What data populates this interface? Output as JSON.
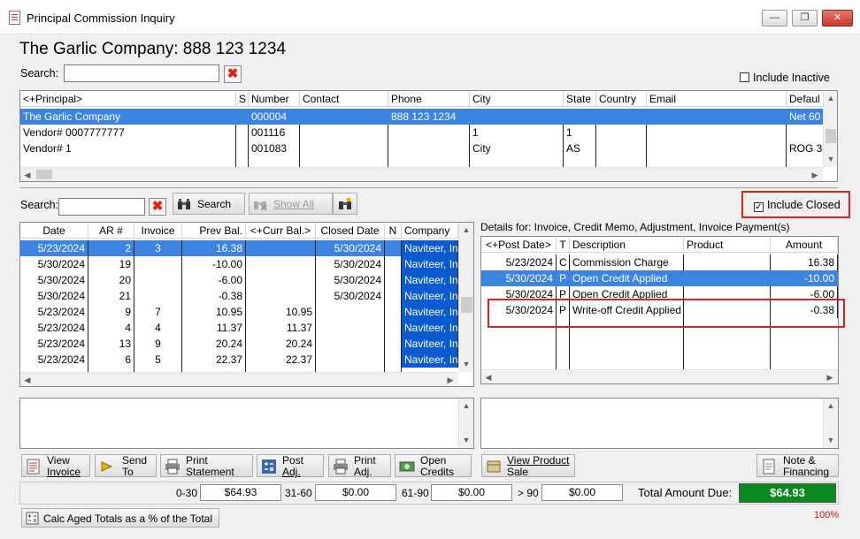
{
  "window": {
    "title": "Principal Commission Inquiry",
    "controls": [
      "minimize",
      "restore",
      "close"
    ]
  },
  "header": {
    "company_title": "The Garlic Company: 888 123 1234"
  },
  "top_search": {
    "label": "Search:",
    "value": "",
    "include_inactive_label": "Include Inactive",
    "include_inactive_checked": false
  },
  "principals": {
    "columns": [
      "<+Principal>",
      "S",
      "Number",
      "Contact",
      "Phone",
      "City",
      "State",
      "Country",
      "Email",
      "Defaul"
    ],
    "rows": [
      {
        "principal": "The Garlic Company",
        "s": "",
        "number": "000004",
        "contact": "",
        "phone": "888 123 1234",
        "city": "",
        "state": "",
        "country": "",
        "email": "",
        "default": "Net 60",
        "selected": true
      },
      {
        "principal": "Vendor# 0007777777",
        "s": "",
        "number": "001116",
        "contact": "",
        "phone": "",
        "city": "1",
        "state": "1",
        "country": "",
        "email": "",
        "default": ""
      },
      {
        "principal": "Vendor# 1",
        "s": "",
        "number": "001083",
        "contact": "",
        "phone": "",
        "city": "City",
        "state": "AS",
        "country": "",
        "email": "",
        "default": "ROG 3"
      }
    ]
  },
  "mid_search": {
    "label": "Search:",
    "value": "",
    "search_label": "Search",
    "show_all_label": "Show All",
    "include_closed_label": "Include Closed",
    "include_closed_checked": true
  },
  "ar": {
    "columns": [
      "Date",
      "AR #",
      "Invoice",
      "Prev Bal.",
      "<+Curr Bal.>",
      "Closed Date",
      "N",
      "Company"
    ],
    "rows": [
      {
        "date": "5/23/2024",
        "ar": "2",
        "invoice": "3",
        "prev": "16.38",
        "curr": "",
        "closed": "5/30/2024",
        "n": "",
        "company": "Naviteer, In",
        "selected": true
      },
      {
        "date": "5/30/2024",
        "ar": "19",
        "invoice": "",
        "prev": "-10.00",
        "curr": "",
        "closed": "5/30/2024",
        "n": "",
        "company": "Naviteer, In"
      },
      {
        "date": "5/30/2024",
        "ar": "20",
        "invoice": "",
        "prev": "-6.00",
        "curr": "",
        "closed": "5/30/2024",
        "n": "",
        "company": "Naviteer, In"
      },
      {
        "date": "5/30/2024",
        "ar": "21",
        "invoice": "",
        "prev": "-0.38",
        "curr": "",
        "closed": "5/30/2024",
        "n": "",
        "company": "Naviteer, In"
      },
      {
        "date": "5/23/2024",
        "ar": "9",
        "invoice": "7",
        "prev": "10.95",
        "curr": "10.95",
        "closed": "",
        "n": "",
        "company": "Naviteer, In"
      },
      {
        "date": "5/23/2024",
        "ar": "4",
        "invoice": "4",
        "prev": "11.37",
        "curr": "11.37",
        "closed": "",
        "n": "",
        "company": "Naviteer, In"
      },
      {
        "date": "5/23/2024",
        "ar": "13",
        "invoice": "9",
        "prev": "20.24",
        "curr": "20.24",
        "closed": "",
        "n": "",
        "company": "Naviteer, In"
      },
      {
        "date": "5/23/2024",
        "ar": "6",
        "invoice": "5",
        "prev": "22.37",
        "curr": "22.37",
        "closed": "",
        "n": "",
        "company": "Naviteer, In"
      }
    ]
  },
  "details": {
    "title": "Details for: Invoice, Credit Memo, Adjustment, Invoice Payment(s)",
    "columns": [
      "<+Post Date>",
      "T",
      "Description",
      "Product",
      "Amount"
    ],
    "rows": [
      {
        "date": "5/23/2024",
        "t": "C",
        "desc": "Commission Charge",
        "product": "",
        "amount": "16.38"
      },
      {
        "date": "5/30/2024",
        "t": "P",
        "desc": "Open Credit Applied",
        "product": "",
        "amount": "-10.00",
        "selected": true
      },
      {
        "date": "5/30/2024",
        "t": "P",
        "desc": "Open Credit Applied",
        "product": "",
        "amount": "-6.00"
      },
      {
        "date": "5/30/2024",
        "t": "P",
        "desc": "Write-off Credit Applied",
        "product": "",
        "amount": "-0.38"
      }
    ]
  },
  "buttons": {
    "view_invoice": [
      "View",
      "Invoice"
    ],
    "send_to": [
      "Send",
      "To"
    ],
    "print_statement": [
      "Print",
      "Statement"
    ],
    "post_adj": [
      "Post",
      "Adj."
    ],
    "print_adj": [
      "Print",
      "Adj."
    ],
    "open_credits": [
      "Open",
      "Credits"
    ],
    "view_product_sale": [
      "View Product",
      "Sale"
    ],
    "note_financing": [
      "Note &",
      "Financing"
    ]
  },
  "aging": {
    "b0_30_label": "0-30",
    "b0_30": "$64.93",
    "b31_60_label": "31-60",
    "b31_60": "$0.00",
    "b61_90_label": "61-90",
    "b61_90": "$0.00",
    "b90_label": "> 90",
    "b90": "$0.00",
    "total_label": "Total Amount Due:",
    "total": "$64.93",
    "total_color": "#0a8a1e"
  },
  "footer": {
    "calc_label": "Calc Aged Totals as a % of the Total",
    "zoom": "100%"
  }
}
